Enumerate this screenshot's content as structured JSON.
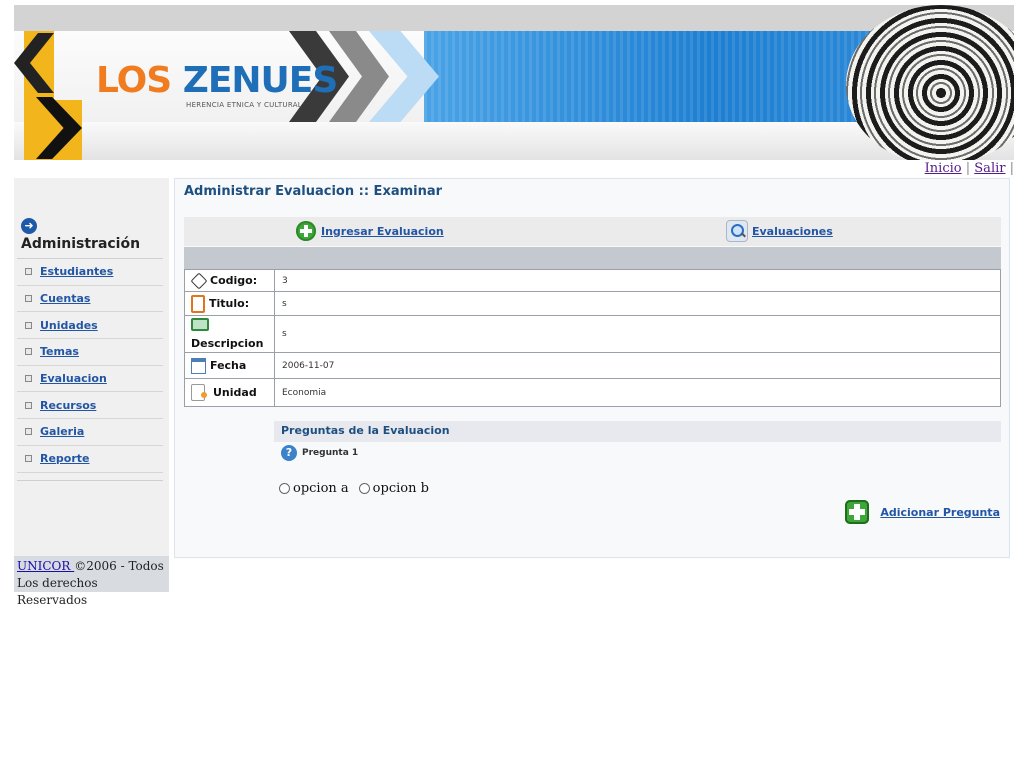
{
  "banner": {
    "brand_los": "LOS",
    "brand_zenues": "ZENUES",
    "tagline": "HERENCIA ETNICA Y CULTURAL"
  },
  "topnav": {
    "inicio": "Inicio",
    "salir": "Salir",
    "separator": "|"
  },
  "sidebar": {
    "title": "Administración",
    "items": [
      {
        "label": " Estudiantes"
      },
      {
        "label": "Cuentas"
      },
      {
        "label": "Unidades"
      },
      {
        "label": " Temas"
      },
      {
        "label": "Evaluacion"
      },
      {
        "label": "Recursos"
      },
      {
        "label": "Galeria"
      },
      {
        "label": "Reporte"
      }
    ],
    "footer_link": "UNICOR ",
    "footer_text": "©2006 - Todos Los derechos Reservados"
  },
  "main": {
    "title": "Administrar Evaluacion :: Examinar",
    "actions": {
      "ingresar": "Ingresar Evaluacion",
      "evaluaciones": "Evaluaciones"
    },
    "details": [
      {
        "label": "Codigo:",
        "value": "3",
        "icon": "tag-icon"
      },
      {
        "label": "Titulo:",
        "value": "s",
        "icon": "clipboard-icon"
      },
      {
        "label": "Descripcion",
        "value": "s",
        "icon": "book-icon"
      },
      {
        "label": "Fecha",
        "value": "2006-11-07",
        "icon": "calendar-icon"
      },
      {
        "label": "Unidad",
        "value": "Economia",
        "icon": "document-icon"
      }
    ],
    "questions_header": "Preguntas de la Evaluacion",
    "question": {
      "title": "Pregunta 1",
      "help_glyph": "?",
      "options": [
        "opcion a",
        "opcion b"
      ]
    },
    "add_question": "Adicionar Pregunta"
  }
}
